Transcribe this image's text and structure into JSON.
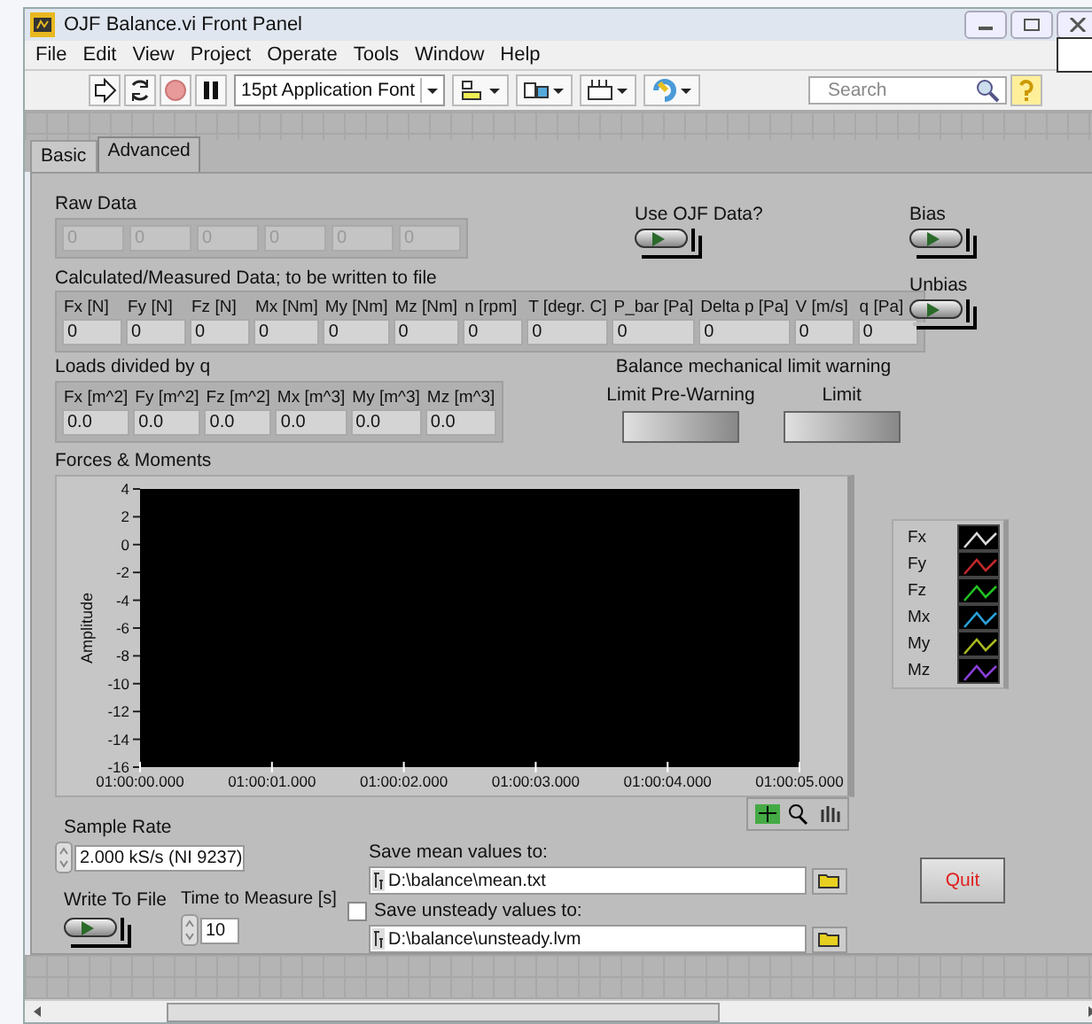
{
  "window": {
    "title": "OJF Balance.vi Front Panel"
  },
  "menu": [
    "File",
    "Edit",
    "View",
    "Project",
    "Operate",
    "Tools",
    "Window",
    "Help"
  ],
  "toolbar": {
    "font": "15pt Application Font",
    "search": {
      "placeholder": "Search"
    }
  },
  "tabs": [
    {
      "label": "Basic",
      "selected": false
    },
    {
      "label": "Advanced",
      "selected": true
    }
  ],
  "raw_data": {
    "label": "Raw Data",
    "disabled": true,
    "values": [
      "0",
      "0",
      "0",
      "0",
      "0",
      "0"
    ]
  },
  "use_ojf": {
    "label": "Use OJF Data?",
    "on": false
  },
  "bias": {
    "label": "Bias",
    "on": false
  },
  "unbias": {
    "label": "Unbias",
    "on": false
  },
  "calculated": {
    "label": "Calculated/Measured Data; to be written to file",
    "fields": [
      {
        "name": "Fx [N]",
        "value": "0"
      },
      {
        "name": "Fy [N]",
        "value": "0"
      },
      {
        "name": "Fz [N]",
        "value": "0"
      },
      {
        "name": "Mx [Nm]",
        "value": "0"
      },
      {
        "name": "My [Nm]",
        "value": "0"
      },
      {
        "name": "Mz [Nm]",
        "value": "0"
      },
      {
        "name": "n [rpm]",
        "value": "0"
      },
      {
        "name": "T [degr. C]",
        "value": "0"
      },
      {
        "name": "P_bar [Pa]",
        "value": "0"
      },
      {
        "name": "Delta p [Pa]",
        "value": "0"
      },
      {
        "name": "V [m/s]",
        "value": "0"
      },
      {
        "name": "q [Pa]",
        "value": "0"
      }
    ]
  },
  "loads": {
    "label": "Loads divided by q",
    "fields": [
      {
        "name": "Fx [m^2]",
        "value": "0.0"
      },
      {
        "name": "Fy [m^2]",
        "value": "0.0"
      },
      {
        "name": "Fz [m^2]",
        "value": "0.0"
      },
      {
        "name": "Mx [m^3]",
        "value": "0.0"
      },
      {
        "name": "My [m^3]",
        "value": "0.0"
      },
      {
        "name": "Mz [m^3]",
        "value": "0.0"
      }
    ]
  },
  "limit_warning": {
    "title": "Balance mechanical limit warning",
    "leds": [
      {
        "label": "Limit Pre-Warning",
        "on": false
      },
      {
        "label": "Limit",
        "on": false
      }
    ]
  },
  "graph": {
    "chart_data": {
      "type": "line",
      "title": "Forces & Moments",
      "ylabel": "Amplitude",
      "ylim": [
        -16,
        4
      ],
      "yticks": [
        4,
        2,
        0,
        -2,
        -4,
        -6,
        -8,
        -10,
        -12,
        -14,
        -16
      ],
      "categories": [
        "01:00:00.000",
        "01:00:01.000",
        "01:00:02.000",
        "01:00:03.000",
        "01:00:04.000",
        "01:00:05.000"
      ]
    }
  },
  "legend": [
    {
      "name": "Fx",
      "color": "#d8d8d8"
    },
    {
      "name": "Fy",
      "color": "#c0282c"
    },
    {
      "name": "Fz",
      "color": "#22c022"
    },
    {
      "name": "Mx",
      "color": "#2aa0d8"
    },
    {
      "name": "My",
      "color": "#a8b820"
    },
    {
      "name": "Mz",
      "color": "#8a3fd8"
    }
  ],
  "sample_rate": {
    "label": "Sample Rate",
    "value": "2.000 kS/s (NI 9237)"
  },
  "write_to_file": {
    "label": "Write To File",
    "on": false
  },
  "time_to_measure": {
    "label": "Time to Measure [s]",
    "value": "10"
  },
  "save_mean": {
    "label": "Save mean values to:",
    "path": "D:\\balance\\mean.txt"
  },
  "save_unsteady": {
    "label": "Save unsteady values to:",
    "checked": false,
    "path": "D:\\balance\\unsteady.lvm"
  },
  "quit": {
    "label": "Quit"
  }
}
